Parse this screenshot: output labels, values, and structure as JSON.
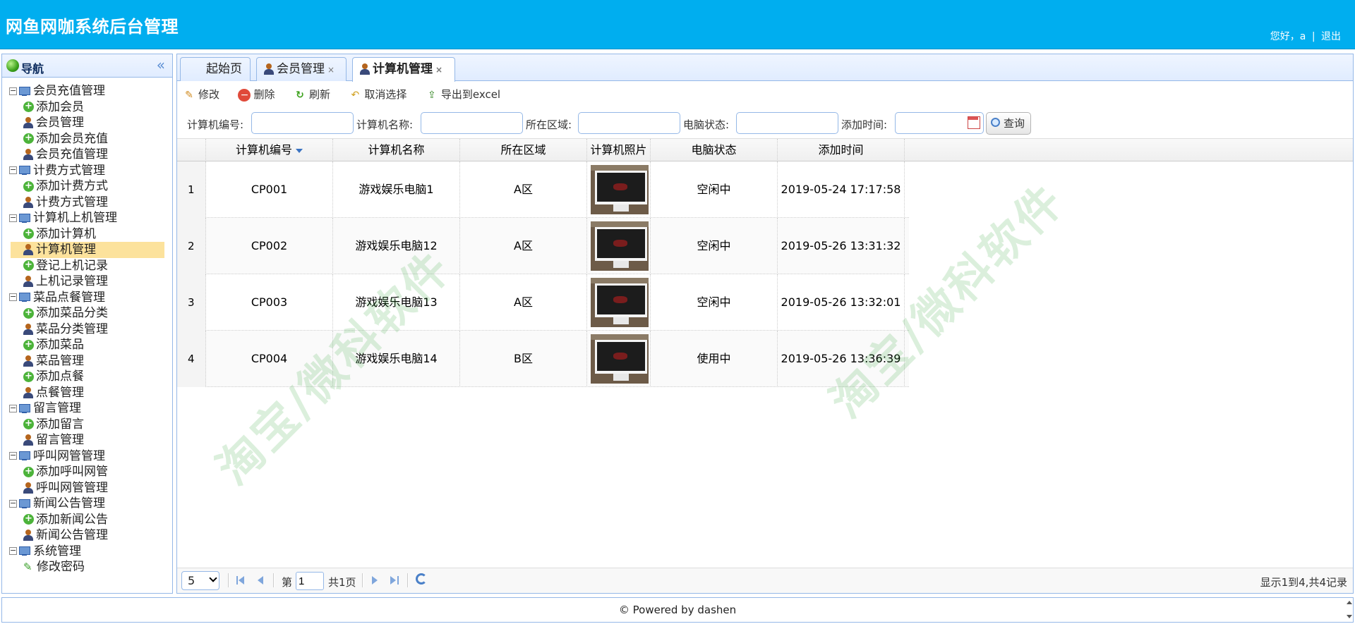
{
  "header": {
    "title": "网鱼网咖系统后台管理",
    "greeting": "您好，a",
    "separator": "|",
    "logout": "退出"
  },
  "sidebar": {
    "title": "导航",
    "collapse_icon": "«",
    "groups": [
      {
        "label": "会员充值管理",
        "items": [
          {
            "label": "添加会员",
            "icon": "add-icon"
          },
          {
            "label": "会员管理",
            "icon": "user-icon"
          },
          {
            "label": "添加会员充值",
            "icon": "add-icon"
          },
          {
            "label": "会员充值管理",
            "icon": "user-icon"
          }
        ]
      },
      {
        "label": "计费方式管理",
        "items": [
          {
            "label": "添加计费方式",
            "icon": "add-icon"
          },
          {
            "label": "计费方式管理",
            "icon": "user-icon"
          }
        ]
      },
      {
        "label": "计算机上机管理",
        "items": [
          {
            "label": "添加计算机",
            "icon": "add-icon"
          },
          {
            "label": "计算机管理",
            "icon": "user-icon",
            "selected": true
          },
          {
            "label": "登记上机记录",
            "icon": "add-icon"
          },
          {
            "label": "上机记录管理",
            "icon": "user-icon"
          }
        ]
      },
      {
        "label": "菜品点餐管理",
        "items": [
          {
            "label": "添加菜品分类",
            "icon": "add-icon"
          },
          {
            "label": "菜品分类管理",
            "icon": "user-icon"
          },
          {
            "label": "添加菜品",
            "icon": "add-icon"
          },
          {
            "label": "菜品管理",
            "icon": "user-icon"
          },
          {
            "label": "添加点餐",
            "icon": "add-icon"
          },
          {
            "label": "点餐管理",
            "icon": "user-icon"
          }
        ]
      },
      {
        "label": "留言管理",
        "items": [
          {
            "label": "添加留言",
            "icon": "add-icon"
          },
          {
            "label": "留言管理",
            "icon": "user-icon"
          }
        ]
      },
      {
        "label": "呼叫网管管理",
        "items": [
          {
            "label": "添加呼叫网管",
            "icon": "add-icon"
          },
          {
            "label": "呼叫网管管理",
            "icon": "user-icon"
          }
        ]
      },
      {
        "label": "新闻公告管理",
        "items": [
          {
            "label": "添加新闻公告",
            "icon": "add-icon"
          },
          {
            "label": "新闻公告管理",
            "icon": "user-icon"
          }
        ]
      },
      {
        "label": "系统管理",
        "items": [
          {
            "label": "修改密码",
            "icon": "pencil-icon"
          }
        ]
      }
    ]
  },
  "tabs": [
    {
      "label": "起始页",
      "closable": false,
      "active": false
    },
    {
      "label": "会员管理",
      "closable": true,
      "active": false
    },
    {
      "label": "计算机管理",
      "closable": true,
      "active": true
    }
  ],
  "tab_close_glyph": "×",
  "toolbar": {
    "edit": "修改",
    "delete": "删除",
    "refresh": "刷新",
    "cancel_select": "取消选择",
    "export": "导出到excel"
  },
  "search": {
    "code_label": "计算机编号:",
    "name_label": "计算机名称:",
    "area_label": "所在区域:",
    "status_label": "电脑状态:",
    "time_label": "添加时间:",
    "query_button": "查询",
    "code_value": "",
    "name_value": "",
    "area_value": "",
    "status_value": "",
    "time_value": ""
  },
  "grid": {
    "columns": [
      "计算机编号",
      "计算机名称",
      "所在区域",
      "计算机照片",
      "电脑状态",
      "添加时间"
    ],
    "rows": [
      {
        "num": "1",
        "code": "CP001",
        "name": "游戏娱乐电脑1",
        "area": "A区",
        "status": "空闲中",
        "time": "2019-05-24 17:17:58"
      },
      {
        "num": "2",
        "code": "CP002",
        "name": "游戏娱乐电脑12",
        "area": "A区",
        "status": "空闲中",
        "time": "2019-05-26 13:31:32"
      },
      {
        "num": "3",
        "code": "CP003",
        "name": "游戏娱乐电脑13",
        "area": "A区",
        "status": "空闲中",
        "time": "2019-05-26 13:32:01"
      },
      {
        "num": "4",
        "code": "CP004",
        "name": "游戏娱乐电脑14",
        "area": "B区",
        "status": "使用中",
        "time": "2019-05-26 13:36:39"
      }
    ]
  },
  "pager": {
    "page_size": "5",
    "page_prefix": "第",
    "page_value": "1",
    "page_total": "共1页",
    "info": "显示1到4,共4记录"
  },
  "watermark": "淘宝/微科软件",
  "footer": "© Powered by dashen",
  "colors": {
    "header_bg": "#00aeef",
    "selected_bg": "#fce29c",
    "border": "#95b8e7"
  }
}
